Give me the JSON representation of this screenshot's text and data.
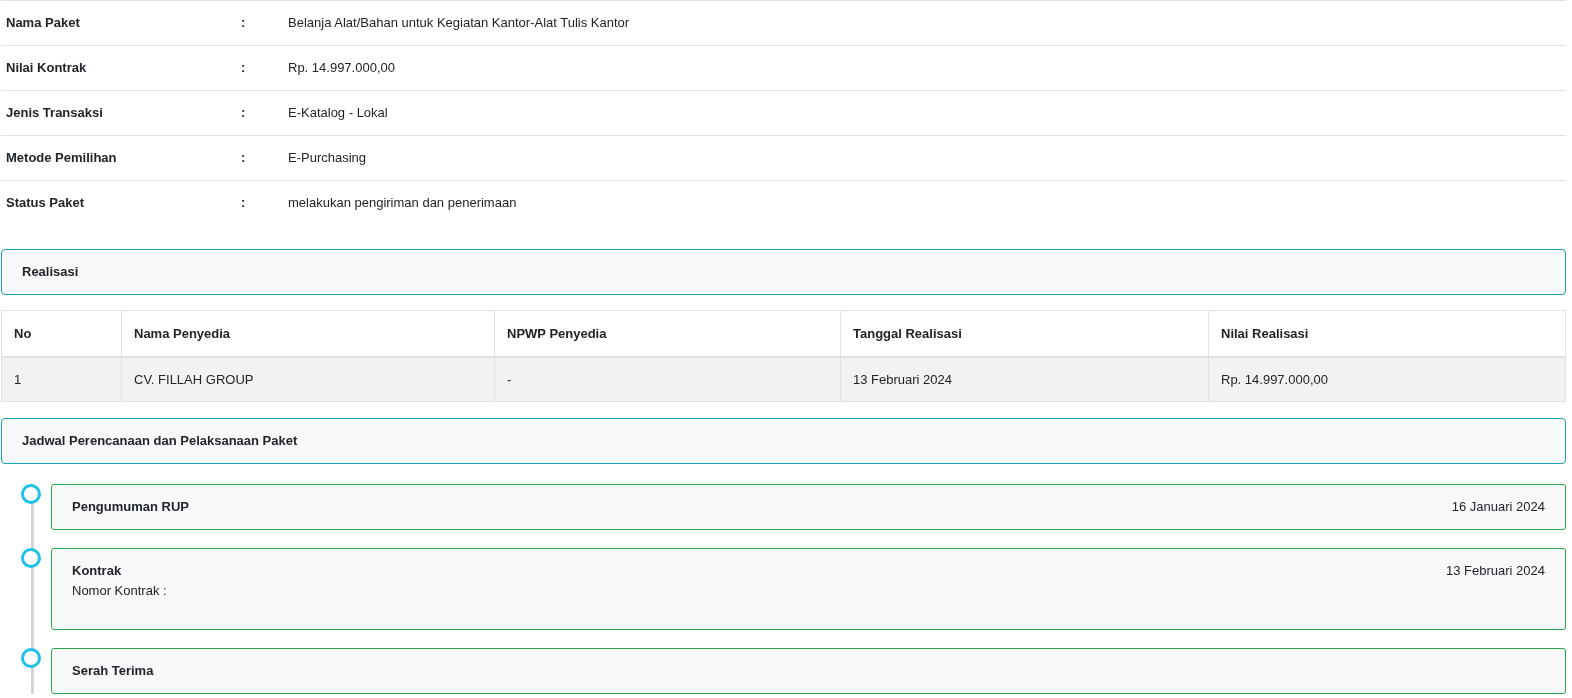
{
  "details": [
    {
      "label": "Nama Paket",
      "separator": ":",
      "value": "Belanja Alat/Bahan untuk Kegiatan Kantor-Alat Tulis Kantor"
    },
    {
      "label": "Nilai Kontrak",
      "separator": ":",
      "value": "Rp. 14.997.000,00"
    },
    {
      "label": "Jenis Transaksi",
      "separator": ":",
      "value": "E-Katalog - Lokal"
    },
    {
      "label": "Metode Pemilihan",
      "separator": ":",
      "value": "E-Purchasing"
    },
    {
      "label": "Status Paket",
      "separator": ":",
      "value": "melakukan pengiriman dan penerimaan"
    }
  ],
  "realisasi": {
    "title": "Realisasi",
    "table": {
      "columns": [
        "No",
        "Nama Penyedia",
        "NPWP Penyedia",
        "Tanggal Realisasi",
        "Nilai Realisasi"
      ],
      "rows": [
        [
          "1",
          "CV. FILLAH GROUP",
          "-",
          "13 Februari 2024",
          "Rp. 14.997.000,00"
        ]
      ]
    }
  },
  "jadwal": {
    "title": "Jadwal Perencanaan dan Pelaksanaan Paket",
    "timeline": [
      {
        "title": "Pengumuman RUP",
        "date": "16 Januari 2024"
      },
      {
        "title": "Kontrak",
        "date": "13 Februari 2024",
        "detail": "Nomor Kontrak :"
      },
      {
        "title": "Serah Terima"
      }
    ]
  }
}
